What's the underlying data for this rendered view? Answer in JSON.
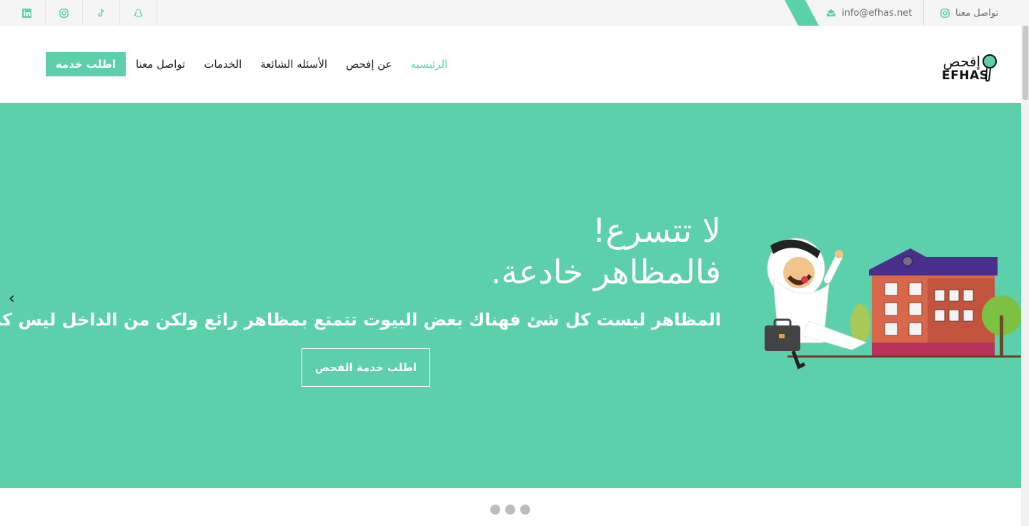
{
  "topbar": {
    "contact_label": "تواصل معنا",
    "email": "info@efhas.net",
    "social_icons": [
      "linkedin-icon",
      "instagram-icon",
      "tiktok-icon",
      "snapchat-icon"
    ]
  },
  "header": {
    "logo_ar": "إفحص",
    "logo_en": "EFHAS",
    "cta_label": "اطلب خدمه",
    "nav": [
      {
        "label": "الرئيسيه",
        "active": true
      },
      {
        "label": "عن إفحص",
        "active": false
      },
      {
        "label": "الأسئله الشائعة",
        "active": false
      },
      {
        "label": "الخدمات",
        "active": false
      },
      {
        "label": "تواصل معنا",
        "active": false
      }
    ]
  },
  "hero": {
    "headline_line1": "لا تتسرع!",
    "headline_line2": "فالمظاهر خادعة.",
    "subtext": "المظاهر ليست كل شئ فهناك بعض البيوت تتمتع بمظاهر رائع ولكن من الداخل ليس كذلك",
    "button_label": "اطلب خدمة الفحص",
    "prev_arrow": "‹",
    "next_arrow": "›"
  },
  "carousel": {
    "dots": 3
  },
  "colors": {
    "accent": "#5bd0ab",
    "roof": "#4a2e8c",
    "brick": "#d9684b"
  }
}
